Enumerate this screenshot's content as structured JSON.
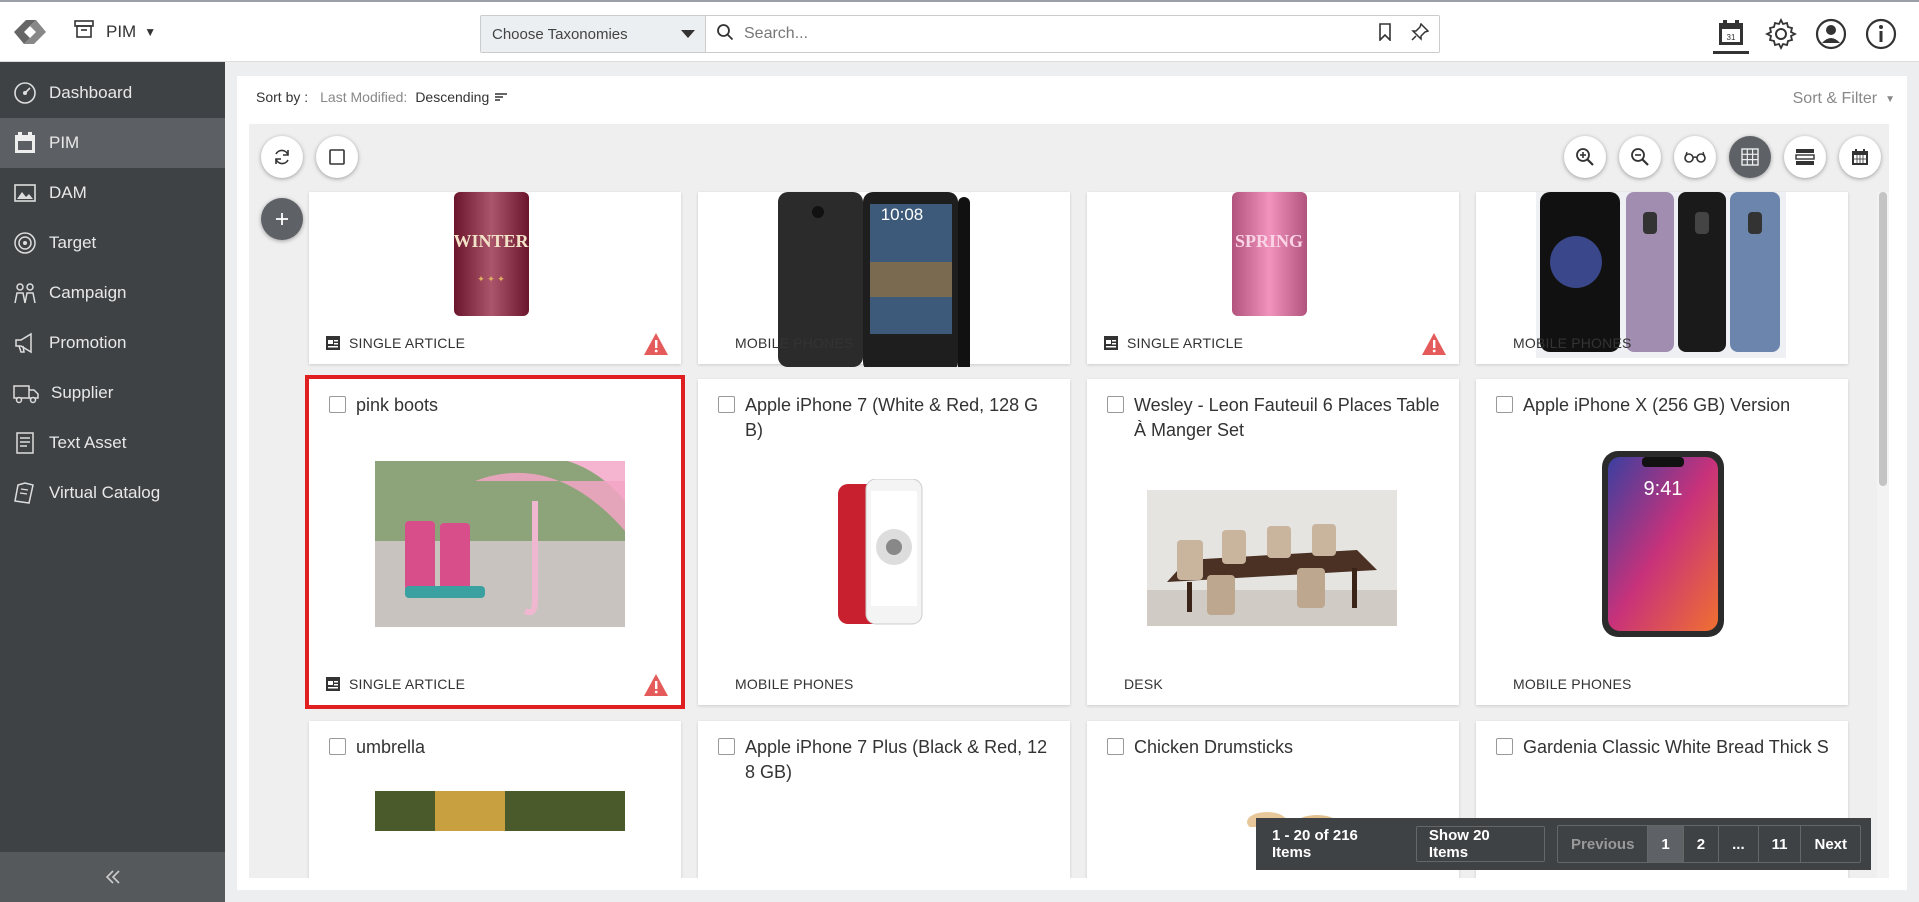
{
  "header": {
    "module_label": "PIM",
    "taxonomy_select": "Choose Taxonomies",
    "search_placeholder": "Search..."
  },
  "sidebar": {
    "items": [
      {
        "label": "Dashboard",
        "icon": "dashboard-icon"
      },
      {
        "label": "PIM",
        "icon": "pim-icon"
      },
      {
        "label": "DAM",
        "icon": "dam-icon"
      },
      {
        "label": "Target",
        "icon": "target-icon"
      },
      {
        "label": "Campaign",
        "icon": "campaign-icon"
      },
      {
        "label": "Promotion",
        "icon": "promotion-icon"
      },
      {
        "label": "Supplier",
        "icon": "supplier-icon"
      },
      {
        "label": "Text Asset",
        "icon": "text-asset-icon"
      },
      {
        "label": "Virtual Catalog",
        "icon": "virtual-catalog-icon"
      }
    ],
    "active": "PIM"
  },
  "sortbar": {
    "label": "Sort by :",
    "field": "Last Modified:",
    "direction": "Descending",
    "sort_filter": "Sort & Filter"
  },
  "cards": [
    {
      "title": "",
      "category": "SINGLE ARTICLE",
      "warning": true
    },
    {
      "title": "",
      "category": "MOBILE PHONES",
      "warning": false
    },
    {
      "title": "",
      "category": "SINGLE ARTICLE",
      "warning": true
    },
    {
      "title": "",
      "category": "MOBILE PHONES",
      "warning": false
    },
    {
      "title": "pink boots",
      "category": "SINGLE ARTICLE",
      "warning": true
    },
    {
      "title": "Apple iPhone 7 (White & Red, 128 GB)",
      "category": "MOBILE PHONES",
      "warning": false
    },
    {
      "title": "Wesley - Leon Fauteuil 6 Places Table À Manger Set",
      "category": "DESK",
      "warning": false
    },
    {
      "title": "Apple iPhone X (256 GB) Version",
      "category": "MOBILE PHONES",
      "warning": false
    },
    {
      "title": "umbrella",
      "category": "",
      "warning": false
    },
    {
      "title": "Apple iPhone 7 Plus (Black & Red, 128 GB)",
      "category": "",
      "warning": false
    },
    {
      "title": "Chicken Drumsticks",
      "category": "",
      "warning": false
    },
    {
      "title": "Gardenia Classic White Bread Thick S",
      "category": "",
      "warning": false
    }
  ],
  "image_text": {
    "winter_can": "WINTER",
    "spring_can": "SPRING",
    "htc_time": "10:08",
    "iphone_time": "9:41"
  },
  "pagination": {
    "summary": "1 - 20 of 216 Items",
    "show": "Show 20 Items",
    "previous": "Previous",
    "pages": [
      "1",
      "2",
      "...",
      "11"
    ],
    "next": "Next",
    "current": "1"
  }
}
